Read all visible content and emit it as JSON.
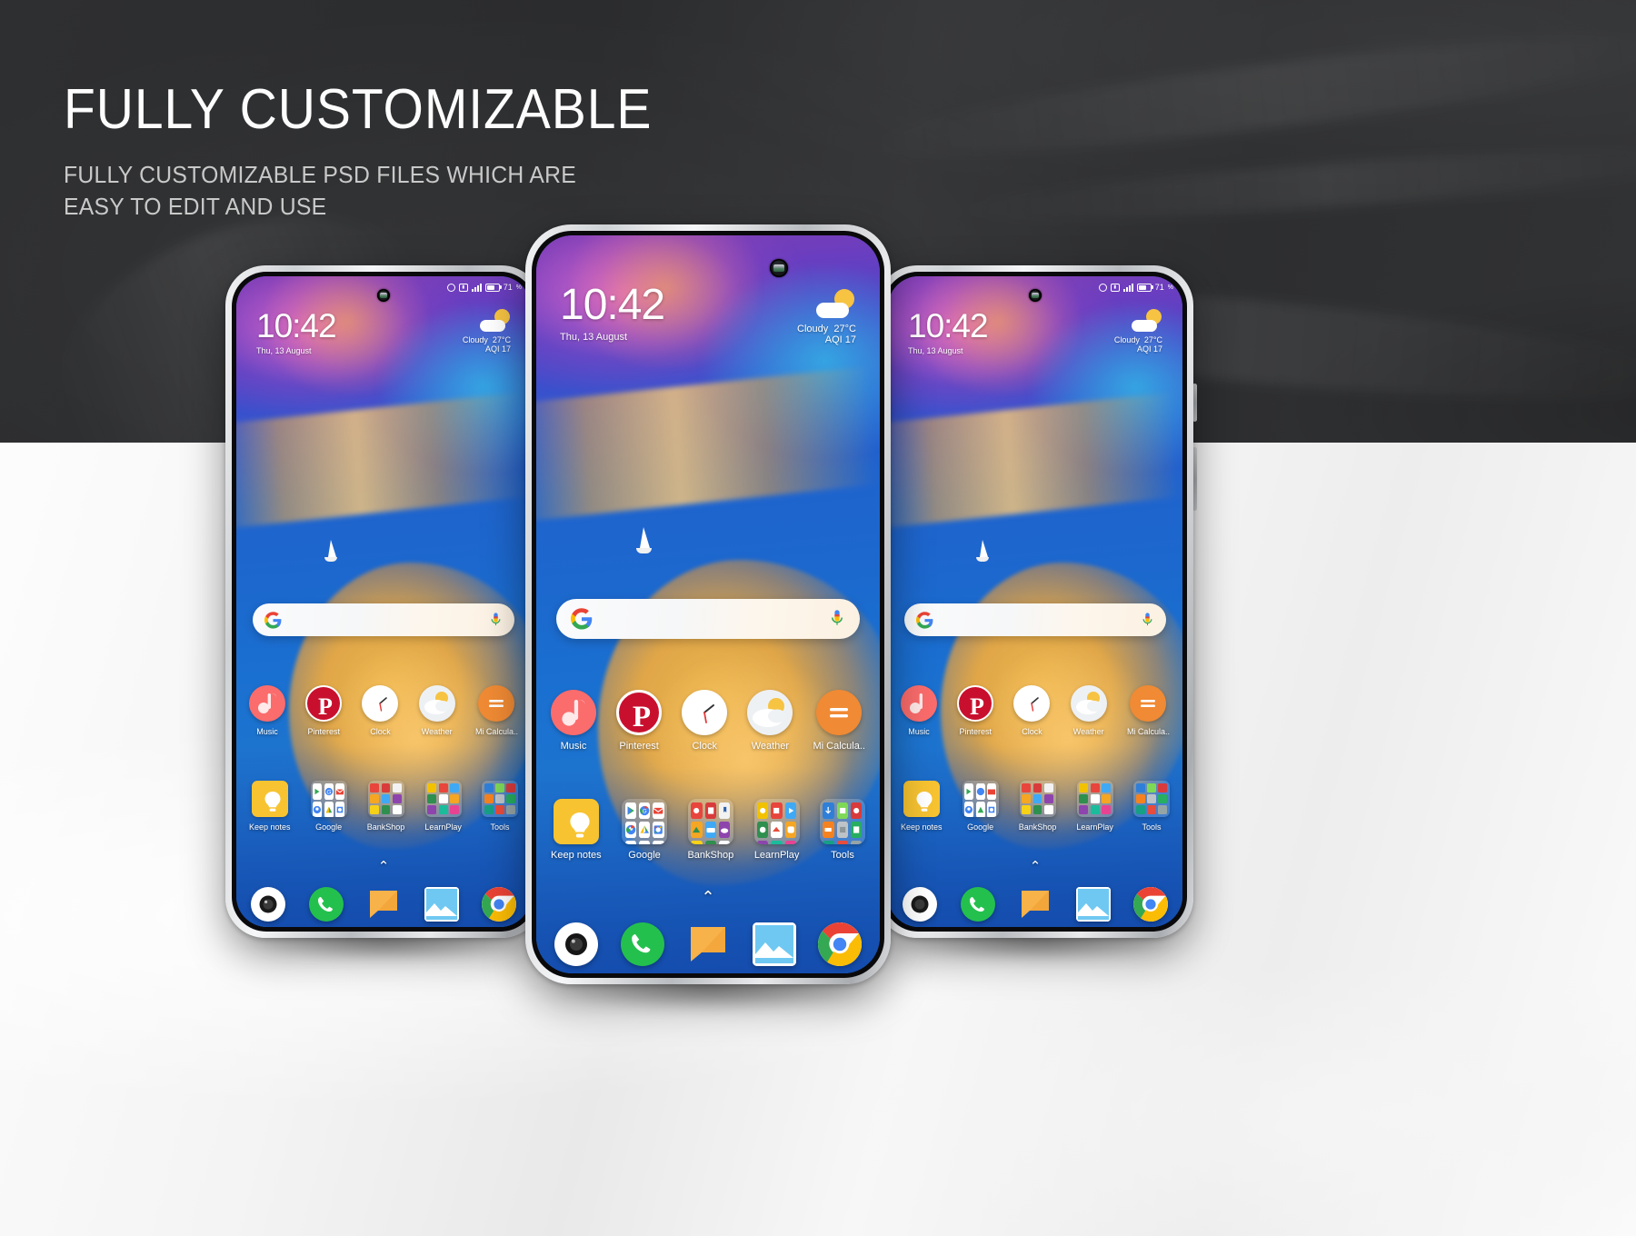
{
  "header": {
    "title": "FULLY CUSTOMIZABLE",
    "subtitle_line1": "FULLY CUSTOMIZABLE PSD FILES WHICH ARE",
    "subtitle_line2": "EASY TO EDIT AND USE"
  },
  "colors": {
    "header_bg": "#2e2f31",
    "title_color": "#fdfdfd",
    "subtitle_color": "#c9c9c9",
    "page_bg": "#f1f1f1",
    "wallpaper_blue": "#1f63cd",
    "wallpaper_sand": "#f6ba4a",
    "wallpaper_magenta": "#e26bc8",
    "accent_red": "#e60023",
    "accent_green": "#27c24c",
    "accent_orange": "#f5a623"
  },
  "phone": {
    "statusbar": {
      "alarm_icon": "alarm-icon",
      "vowifi_icon": "vowifi-icon",
      "signal_icon": "signal-bars-icon",
      "battery_icon": "battery-icon",
      "battery_level": "71"
    },
    "camera_icon": "front-camera-punchhole-icon",
    "clock": {
      "time": "10:42",
      "date": "Thu, 13 August"
    },
    "weather": {
      "icon": "sun-behind-cloud-icon",
      "condition": "Cloudy",
      "temperature": "27°C",
      "aqi": "AQI 17"
    },
    "search": {
      "google_icon": "google-g-icon",
      "mic_icon": "microphone-icon",
      "placeholder": ""
    },
    "apps": [
      {
        "label": "Music",
        "icon": "music-note-icon",
        "color": "#fb6c6c"
      },
      {
        "label": "Pinterest",
        "icon": "pinterest-icon",
        "color": "#c8102e"
      },
      {
        "label": "Clock",
        "icon": "analog-clock-icon",
        "color": "#ffffff"
      },
      {
        "label": "Weather",
        "icon": "weather-cloud-icon",
        "color": "#f2f4f6"
      },
      {
        "label": "Mi Calcula..",
        "icon": "calculator-icon",
        "color": "#f08a34"
      }
    ],
    "folders": [
      {
        "label": "Keep notes",
        "icon": "lightbulb-icon",
        "color": "#f7c331"
      },
      {
        "label": "Google",
        "icon": "google-folder-icon",
        "color": "#2f7fd8"
      },
      {
        "label": "BankShop",
        "icon": "bankshop-folder-icon",
        "color": "#2f7fd8"
      },
      {
        "label": "LearnPlay",
        "icon": "learnplay-folder-icon",
        "color": "#2f7fd8"
      },
      {
        "label": "Tools",
        "icon": "tools-folder-icon",
        "color": "#2f7fd8"
      }
    ],
    "page_indicator_icon": "chevron-up-icon",
    "dock": [
      {
        "label": "Camera",
        "icon": "camera-icon",
        "color": "#ffffff"
      },
      {
        "label": "Phone",
        "icon": "phone-icon",
        "color": "#24c04e"
      },
      {
        "label": "Messages",
        "icon": "messages-icon",
        "color": "#f7b24a"
      },
      {
        "label": "Gallery",
        "icon": "gallery-icon",
        "color": "#ffffff"
      },
      {
        "label": "Chrome",
        "icon": "chrome-icon",
        "color": "#ffffff"
      }
    ]
  },
  "mockups": [
    {
      "name": "phone-left",
      "position": "left"
    },
    {
      "name": "phone-center",
      "position": "center"
    },
    {
      "name": "phone-right",
      "position": "right"
    }
  ]
}
